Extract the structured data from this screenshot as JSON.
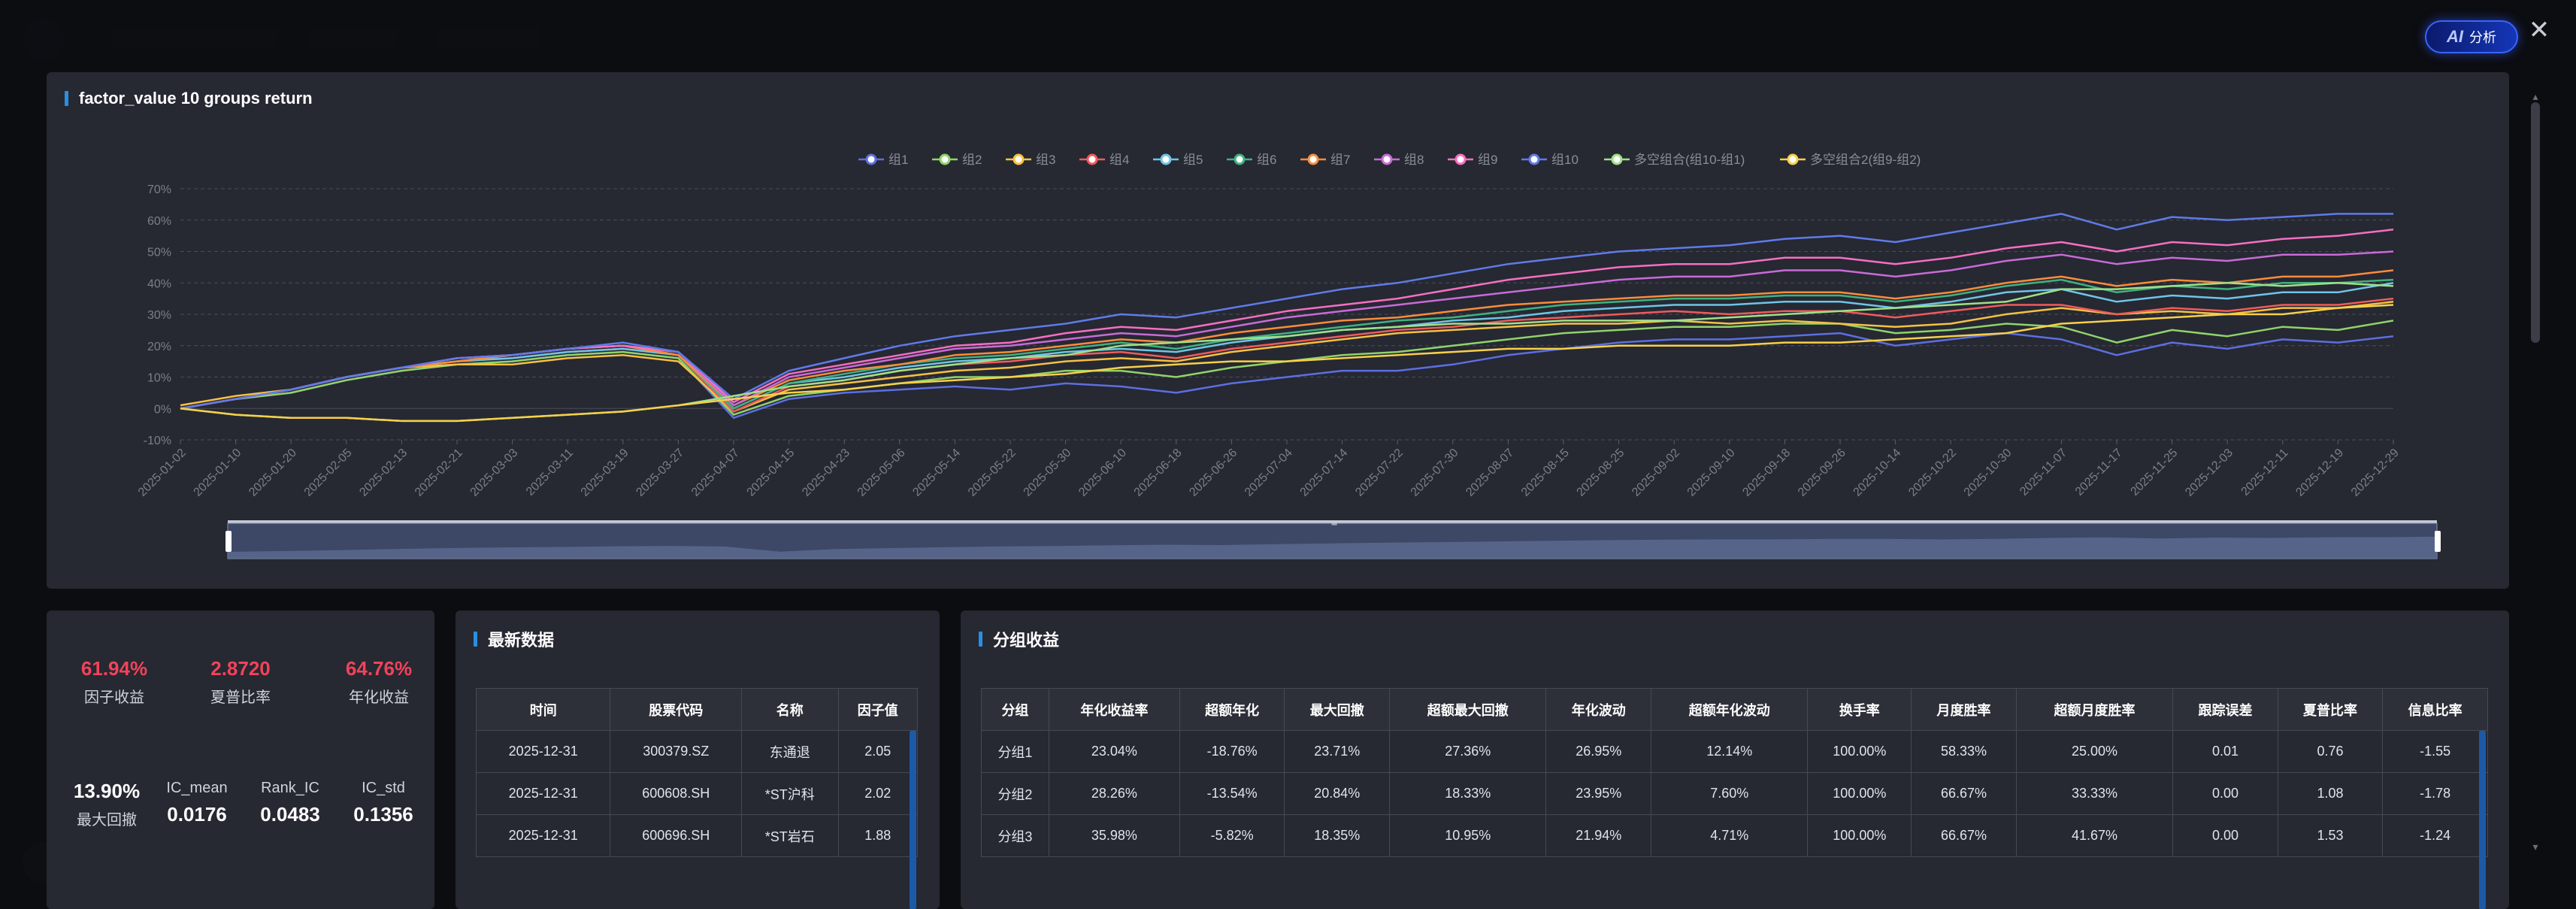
{
  "ai_button": {
    "icon": "AI",
    "label": "分析"
  },
  "close_icon": "✕",
  "chart_panel": {
    "title": "factor_value 10 groups return"
  },
  "chart_data": {
    "type": "line",
    "title": "factor_value 10 groups return",
    "ylim": [
      -10,
      70
    ],
    "yticks": [
      "-10%",
      "0%",
      "10%",
      "20%",
      "30%",
      "40%",
      "50%",
      "60%",
      "70%"
    ],
    "grid": true,
    "legend_position": "top-center",
    "x": [
      "2025-01-02",
      "2025-01-10",
      "2025-01-20",
      "2025-02-05",
      "2025-02-13",
      "2025-02-21",
      "2025-03-03",
      "2025-03-11",
      "2025-03-19",
      "2025-03-27",
      "2025-04-07",
      "2025-04-15",
      "2025-04-23",
      "2025-05-06",
      "2025-05-14",
      "2025-05-22",
      "2025-05-30",
      "2025-06-10",
      "2025-06-18",
      "2025-06-26",
      "2025-07-04",
      "2025-07-14",
      "2025-07-22",
      "2025-07-30",
      "2025-08-07",
      "2025-08-15",
      "2025-08-25",
      "2025-09-02",
      "2025-09-10",
      "2025-09-18",
      "2025-09-26",
      "2025-10-14",
      "2025-10-22",
      "2025-10-30",
      "2025-11-07",
      "2025-11-17",
      "2025-11-25",
      "2025-12-03",
      "2025-12-11",
      "2025-12-19",
      "2025-12-29"
    ],
    "series": [
      {
        "name": "组1",
        "color": "#5b6fe0",
        "values": [
          0,
          3,
          5,
          9,
          12,
          14,
          15,
          17,
          18,
          16,
          -3,
          3,
          5,
          6,
          7,
          6,
          8,
          7,
          5,
          8,
          10,
          12,
          12,
          14,
          17,
          19,
          21,
          22,
          22,
          23,
          24,
          20,
          22,
          24,
          22,
          17,
          21,
          19,
          22,
          21,
          23
        ]
      },
      {
        "name": "组2",
        "color": "#8fd36a",
        "values": [
          0,
          3,
          5,
          9,
          12,
          14,
          15,
          17,
          18,
          16,
          -2,
          4,
          6,
          8,
          10,
          10,
          12,
          12,
          10,
          13,
          15,
          17,
          18,
          20,
          22,
          24,
          25,
          26,
          26,
          27,
          27,
          24,
          25,
          27,
          26,
          21,
          25,
          23,
          26,
          25,
          28
        ]
      },
      {
        "name": "组3",
        "color": "#f5c143",
        "values": [
          1,
          4,
          6,
          10,
          13,
          14,
          14,
          16,
          17,
          15,
          -1,
          6,
          8,
          10,
          12,
          13,
          15,
          16,
          15,
          18,
          20,
          22,
          24,
          25,
          26,
          27,
          27,
          28,
          27,
          28,
          27,
          26,
          27,
          30,
          32,
          30,
          31,
          30,
          32,
          32,
          34
        ]
      },
      {
        "name": "组4",
        "color": "#ef5b5b",
        "values": [
          0,
          3,
          6,
          10,
          13,
          15,
          16,
          18,
          19,
          17,
          -1,
          7,
          9,
          12,
          14,
          15,
          17,
          18,
          16,
          19,
          21,
          23,
          25,
          26,
          28,
          29,
          30,
          31,
          30,
          31,
          31,
          29,
          31,
          33,
          33,
          30,
          32,
          31,
          33,
          33,
          35
        ]
      },
      {
        "name": "组5",
        "color": "#6ec5e6",
        "values": [
          0,
          3,
          6,
          10,
          13,
          15,
          16,
          18,
          19,
          17,
          0,
          8,
          10,
          13,
          15,
          16,
          18,
          19,
          18,
          21,
          23,
          25,
          26,
          28,
          29,
          31,
          32,
          33,
          33,
          34,
          34,
          32,
          34,
          37,
          38,
          34,
          36,
          35,
          37,
          37,
          40
        ]
      },
      {
        "name": "组6",
        "color": "#3fb27f",
        "values": [
          0,
          3,
          6,
          10,
          13,
          15,
          17,
          19,
          20,
          17,
          0,
          8,
          11,
          14,
          16,
          17,
          19,
          21,
          19,
          22,
          24,
          26,
          28,
          29,
          31,
          33,
          34,
          35,
          35,
          36,
          36,
          34,
          36,
          39,
          41,
          37,
          39,
          38,
          40,
          40,
          41
        ]
      },
      {
        "name": "组7",
        "color": "#fb8c3c",
        "values": [
          0,
          3,
          6,
          10,
          13,
          15,
          17,
          19,
          20,
          17,
          1,
          9,
          12,
          14,
          17,
          18,
          20,
          22,
          21,
          24,
          26,
          28,
          29,
          31,
          33,
          34,
          35,
          36,
          36,
          37,
          37,
          35,
          37,
          40,
          42,
          39,
          41,
          40,
          42,
          42,
          44
        ]
      },
      {
        "name": "组8",
        "color": "#c86bd6",
        "values": [
          0,
          3,
          6,
          10,
          13,
          16,
          17,
          19,
          20,
          18,
          1,
          10,
          13,
          16,
          19,
          20,
          22,
          24,
          23,
          26,
          29,
          31,
          33,
          35,
          37,
          39,
          41,
          42,
          42,
          44,
          44,
          42,
          44,
          47,
          49,
          46,
          48,
          47,
          49,
          49,
          50
        ]
      },
      {
        "name": "组9",
        "color": "#f56fc1",
        "values": [
          0,
          3,
          6,
          10,
          13,
          16,
          17,
          19,
          20,
          18,
          2,
          11,
          14,
          17,
          20,
          21,
          24,
          26,
          25,
          28,
          31,
          33,
          35,
          38,
          41,
          43,
          45,
          46,
          46,
          48,
          48,
          46,
          48,
          51,
          53,
          50,
          53,
          52,
          54,
          55,
          57
        ]
      },
      {
        "name": "组10",
        "color": "#5f7be8",
        "values": [
          0,
          3,
          6,
          10,
          13,
          16,
          17,
          19,
          21,
          18,
          3,
          12,
          16,
          20,
          23,
          25,
          27,
          30,
          29,
          32,
          35,
          38,
          40,
          43,
          46,
          48,
          50,
          51,
          52,
          54,
          55,
          53,
          56,
          59,
          62,
          57,
          61,
          60,
          61,
          62,
          62
        ]
      },
      {
        "name": "多空组合(组10-组1)",
        "color": "#9fe088",
        "values": [
          0,
          -2,
          -3,
          -3,
          -4,
          -4,
          -3,
          -2,
          -1,
          1,
          4,
          7,
          9,
          12,
          14,
          16,
          17,
          20,
          21,
          22,
          23,
          25,
          26,
          27,
          27,
          28,
          28,
          28,
          29,
          30,
          31,
          32,
          33,
          34,
          38,
          38,
          39,
          40,
          39,
          40,
          39
        ]
      },
      {
        "name": "多空组合2(组9-组2)",
        "color": "#f7d04a",
        "values": [
          0,
          -2,
          -3,
          -3,
          -4,
          -4,
          -3,
          -2,
          -1,
          1,
          3,
          5,
          6,
          8,
          9,
          10,
          11,
          13,
          14,
          15,
          15,
          16,
          17,
          18,
          19,
          19,
          20,
          20,
          20,
          21,
          21,
          22,
          23,
          24,
          27,
          28,
          29,
          30,
          30,
          32,
          33
        ]
      }
    ]
  },
  "stats": {
    "factor_return": {
      "value": "61.94%",
      "label": "因子收益"
    },
    "sharpe": {
      "value": "2.8720",
      "label": "夏普比率"
    },
    "annual_return": {
      "value": "64.76%",
      "label": "年化收益"
    },
    "max_drawdown": {
      "value": "13.90%",
      "label": "最大回撤"
    },
    "ic_mean": {
      "value": "0.0176",
      "label": "IC_mean"
    },
    "rank_ic": {
      "value": "0.0483",
      "label": "Rank_IC"
    },
    "ic_std": {
      "value": "0.1356",
      "label": "IC_std"
    }
  },
  "latest": {
    "title": "最新数据",
    "columns": [
      "时间",
      "股票代码",
      "名称",
      "因子值"
    ],
    "rows": [
      [
        "2025-12-31",
        "300379.SZ",
        "东通退",
        "2.05"
      ],
      [
        "2025-12-31",
        "600608.SH",
        "*ST沪科",
        "2.02"
      ],
      [
        "2025-12-31",
        "600696.SH",
        "*ST岩石",
        "1.88"
      ]
    ]
  },
  "groups": {
    "title": "分组收益",
    "columns": [
      "分组",
      "年化收益率",
      "超额年化",
      "最大回撤",
      "超额最大回撤",
      "年化波动",
      "超额年化波动",
      "换手率",
      "月度胜率",
      "超额月度胜率",
      "跟踪误差",
      "夏普比率",
      "信息比率"
    ],
    "rows": [
      [
        "分组1",
        "23.04%",
        "-18.76%",
        "23.71%",
        "27.36%",
        "26.95%",
        "12.14%",
        "100.00%",
        "58.33%",
        "25.00%",
        "0.01",
        "0.76",
        "-1.55"
      ],
      [
        "分组2",
        "28.26%",
        "-13.54%",
        "20.84%",
        "18.33%",
        "23.95%",
        "7.60%",
        "100.00%",
        "66.67%",
        "33.33%",
        "0.00",
        "1.08",
        "-1.78"
      ],
      [
        "分组3",
        "35.98%",
        "-5.82%",
        "18.35%",
        "10.95%",
        "21.94%",
        "4.71%",
        "100.00%",
        "66.67%",
        "41.67%",
        "0.00",
        "1.53",
        "-1.24"
      ]
    ]
  }
}
